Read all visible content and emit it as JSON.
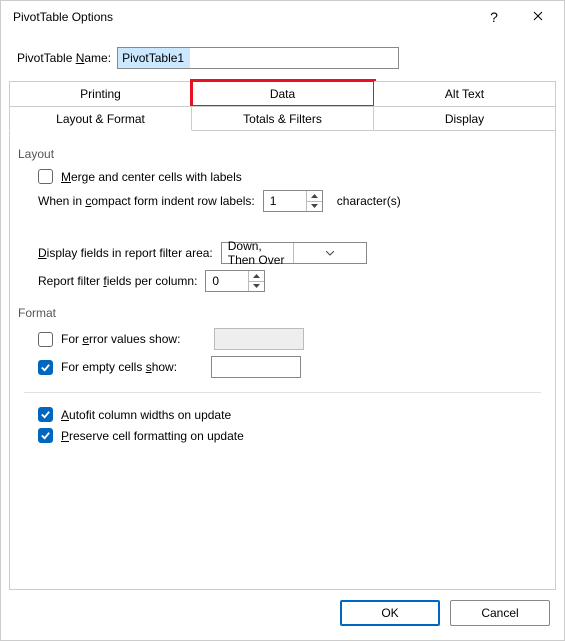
{
  "dialog": {
    "title": "PivotTable Options",
    "help_tooltip": "?",
    "close_tooltip": "Close"
  },
  "name": {
    "label_pre": "PivotTable ",
    "label_u": "N",
    "label_post": "ame:",
    "value": "PivotTable1"
  },
  "tabs": {
    "printing": "Printing",
    "data": "Data",
    "alt_text": "Alt Text",
    "layout_format": "Layout & Format",
    "totals_filters": "Totals & Filters",
    "display": "Display"
  },
  "layout": {
    "group_label": "Layout",
    "merge_pre": "",
    "merge_u": "M",
    "merge_post": "erge and center cells with labels",
    "merge_checked": false,
    "indent_pre": "When in ",
    "indent_u": "c",
    "indent_post": "ompact form indent row labels:",
    "indent_value": "1",
    "indent_suffix": "character(s)",
    "displayfields_pre": "",
    "displayfields_u": "D",
    "displayfields_post": "isplay fields in report filter area:",
    "displayfields_value": "Down, Then Over",
    "reportfilter_pre": "Report filter ",
    "reportfilter_u": "f",
    "reportfilter_post": "ields per column:",
    "reportfilter_value": "0"
  },
  "format": {
    "group_label": "Format",
    "error_pre": "For ",
    "error_u": "e",
    "error_post": "rror values show:",
    "error_checked": false,
    "error_value": "",
    "empty_pre": "For empty cells ",
    "empty_u": "s",
    "empty_post": "how:",
    "empty_checked": true,
    "empty_value": "",
    "autofit_pre": "",
    "autofit_u": "A",
    "autofit_post": "utofit column widths on update",
    "autofit_checked": true,
    "preserve_pre": "",
    "preserve_u": "P",
    "preserve_post": "reserve cell formatting on update",
    "preserve_checked": true
  },
  "footer": {
    "ok": "OK",
    "cancel": "Cancel"
  }
}
